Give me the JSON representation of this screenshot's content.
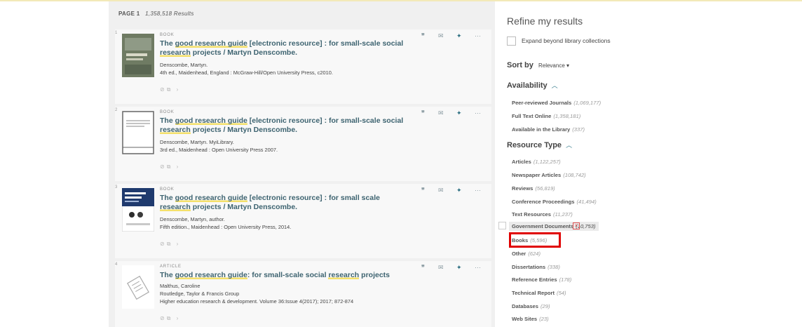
{
  "header": {
    "page_label": "PAGE 1",
    "results_count": "1,358,518 Results"
  },
  "results": [
    {
      "num": "1",
      "type": "BOOK",
      "title_parts": [
        {
          "text": "The ",
          "hl": false
        },
        {
          "text": "good research guide",
          "hl": true
        },
        {
          "text": " [electronic resource] : for small-scale social ",
          "hl": false
        },
        {
          "text": "research",
          "hl": true
        },
        {
          "text": " projects / Martyn Denscombe.",
          "hl": false
        }
      ],
      "meta": [
        "Denscombe, Martyn.",
        "4th ed., Maidenhead, England : McGraw-Hill/Open University Press, c2010."
      ]
    },
    {
      "num": "2",
      "type": "BOOK",
      "title_parts": [
        {
          "text": "The ",
          "hl": false
        },
        {
          "text": "good research guide",
          "hl": true
        },
        {
          "text": " [electronic resource] : for small-scale social ",
          "hl": false
        },
        {
          "text": "research",
          "hl": true
        },
        {
          "text": " projects / Martyn Denscombe.",
          "hl": false
        }
      ],
      "meta": [
        "Denscombe, Martyn. MyiLibrary.",
        "3rd ed., Maidenhead : Open University Press 2007."
      ]
    },
    {
      "num": "3",
      "type": "BOOK",
      "title_parts": [
        {
          "text": "The ",
          "hl": false
        },
        {
          "text": "good research guide",
          "hl": true
        },
        {
          "text": " [electronic resource] : for small scale ",
          "hl": false
        },
        {
          "text": "research",
          "hl": true
        },
        {
          "text": " projects / Martyn Denscombe.",
          "hl": false
        }
      ],
      "meta": [
        "Denscombe, Martyn, author.",
        "Fifth edition., Maidenhead : Open University Press, 2014."
      ]
    },
    {
      "num": "4",
      "type": "ARTICLE",
      "title_parts": [
        {
          "text": "The ",
          "hl": false
        },
        {
          "text": "good research guide",
          "hl": true
        },
        {
          "text": ": for small-scale social ",
          "hl": false
        },
        {
          "text": "research",
          "hl": true
        },
        {
          "text": " projects",
          "hl": false
        }
      ],
      "meta": [
        "Malthus, Caroline",
        "Routledge, Taylor & Francis Group",
        "Higher education research & development. Volume 36:Issue 4(2017); 2017; 872-874"
      ]
    }
  ],
  "facets": {
    "heading": "Refine my results",
    "expand_label": "Expand beyond library collections",
    "sort_label": "Sort by",
    "sort_value": "Relevance ▾",
    "availability": {
      "title": "Availability",
      "items": [
        {
          "label": "Peer-reviewed Journals",
          "count": "(1,069,177)"
        },
        {
          "label": "Full Text Online",
          "count": "(1,358,181)"
        },
        {
          "label": "Available in the Library",
          "count": "(337)"
        }
      ]
    },
    "resource_type": {
      "title": "Resource Type",
      "items": [
        {
          "label": "Articles",
          "count": "(1,122,257)"
        },
        {
          "label": "Newspaper Articles",
          "count": "(108,742)"
        },
        {
          "label": "Reviews",
          "count": "(56,819)"
        },
        {
          "label": "Conference Proceedings",
          "count": "(41,494)"
        },
        {
          "label": "Text Resources",
          "count": "(11,237)"
        },
        {
          "label": "Government Documents",
          "count": "(10,753)"
        },
        {
          "label": "Books",
          "count": "(5,596)"
        },
        {
          "label": "Other",
          "count": "(624)"
        },
        {
          "label": "Dissertations",
          "count": "(338)"
        },
        {
          "label": "Reference Entries",
          "count": "(178)"
        },
        {
          "label": "Technical Report",
          "count": "(54)"
        },
        {
          "label": "Databases",
          "count": "(29)"
        },
        {
          "label": "Web Sites",
          "count": "(23)"
        }
      ]
    }
  },
  "icons": {
    "quote": "quote-icon",
    "mail": "mail-icon",
    "pin": "pin-icon",
    "more": "more-icon",
    "link": "link-icon",
    "external": "external-link-icon",
    "chevron": "chevron-up-icon",
    "exclude": "exclude-icon"
  },
  "colors": {
    "title": "#3d6370",
    "highlight": "#f4e06a",
    "annotation": "#e00000",
    "accent": "#3a7f8f"
  }
}
